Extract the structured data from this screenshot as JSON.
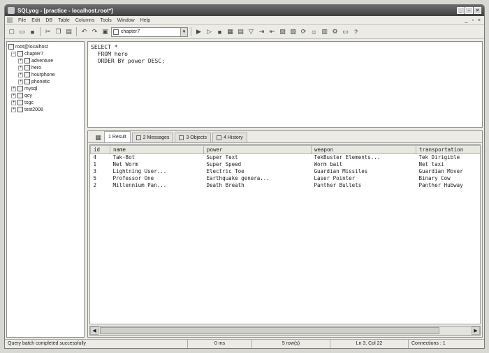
{
  "window": {
    "title": "SQLyog - [practice - localhost.root*]",
    "controls": [
      "_",
      "▫",
      "×"
    ]
  },
  "menubar": {
    "items": [
      "File",
      "Edit",
      "DB",
      "Table",
      "Columns",
      "Tools",
      "Window",
      "Help"
    ],
    "mdi_controls": "_ ▫ ×"
  },
  "toolbar": {
    "database_select": "chapter7"
  },
  "tree": {
    "root": "root@localhost",
    "databases": [
      {
        "name": "chapter7",
        "expanded": true,
        "children": [
          "adventure",
          "hero",
          "hourphone",
          "phonetic"
        ]
      },
      {
        "name": "mysql",
        "expanded": false
      },
      {
        "name": "qcy",
        "expanded": false
      },
      {
        "name": "tsgc",
        "expanded": false
      },
      {
        "name": "test2008",
        "expanded": false
      }
    ]
  },
  "editor": {
    "lines": [
      "SELECT *",
      "  FROM hero",
      "  ORDER BY power DESC;"
    ]
  },
  "tabs": [
    {
      "label": "1 Result",
      "active": true
    },
    {
      "label": "2 Messages",
      "active": false
    },
    {
      "label": "3 Objects",
      "active": false
    },
    {
      "label": "4 History",
      "active": false
    }
  ],
  "result_table": {
    "columns": [
      "id",
      "name",
      "power",
      "weapon",
      "transportation"
    ],
    "rows": [
      [
        "4",
        "Tak-Bot",
        "Super Text",
        "TekBuster Elements...",
        "Tek Dirigible"
      ],
      [
        "1",
        "Net Worm",
        "Super Speed",
        "Worm bait",
        "Net taxi"
      ],
      [
        "3",
        "Lightning User...",
        "Electric Toe",
        "Guardian Missiles",
        "Guardian Mover"
      ],
      [
        "5",
        "Professor One",
        "Earthquake genera...",
        "Laser Pointer",
        "Binary Cow"
      ],
      [
        "2",
        "Millennium Pan...",
        "Death Breath",
        "Panther Bullets",
        "Panther Hubway"
      ]
    ]
  },
  "statusbar": {
    "message": "Query batch completed successfully",
    "time": "0 ms",
    "rows": "5 row(s)",
    "position": "Ln 3, Col 22",
    "connections": "Connections : 1"
  }
}
